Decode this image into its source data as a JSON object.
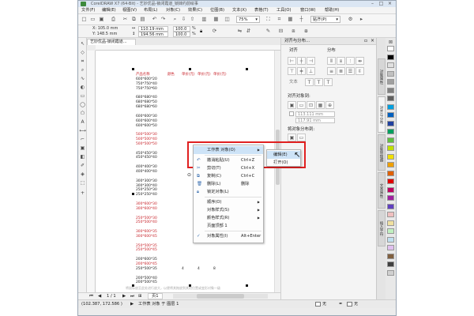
{
  "app": {
    "title": "CorelDRAW X7 (64-Bit) - 艺妙优品-锁闭霞道_锁妹约前绘事"
  },
  "menubar": [
    "文件(F)",
    "编辑(E)",
    "视图(V)",
    "布局(L)",
    "对象(C)",
    "效果(C)",
    "位图(B)",
    "文本(X)",
    "表格(T)",
    "工具(O)",
    "窗口(W)",
    "帮助(H)"
  ],
  "toolbar": {
    "zoom": "75%",
    "snap": "贴齐(P)"
  },
  "propbar": {
    "x": "X: 105.0 mm",
    "y": "Y: 148.5 mm",
    "w": "110.19 mm",
    "h": "194.56 mm",
    "sx": "100.0",
    "sy": "100.0",
    "pct": "%"
  },
  "doc_tab": "艺妙优品-锁闭霞道...",
  "canvas_table": {
    "header": [
      "产品名称",
      "颜色",
      "单价(元)",
      "单价(元)",
      "单价(元)"
    ],
    "rows": [
      [
        "600*600*20",
        "",
        "",
        "",
        ""
      ],
      [
        "750*750*40",
        "",
        "",
        "",
        ""
      ],
      [
        "750*750*60",
        "",
        "",
        "",
        ""
      ],
      [
        "",
        "",
        "",
        "",
        ""
      ],
      [
        "680*680*40",
        "",
        "",
        "",
        ""
      ],
      [
        "680*680*50",
        "",
        "",
        "",
        ""
      ],
      [
        "680*680*60",
        "",
        "",
        "",
        ""
      ],
      [
        "",
        "",
        "",
        "",
        ""
      ],
      [
        "600*600*30",
        "",
        "",
        "",
        ""
      ],
      [
        "600*600*40",
        "",
        "",
        "",
        ""
      ],
      [
        "600*600*50",
        "",
        "",
        "",
        ""
      ],
      [
        "",
        "",
        "",
        "",
        ""
      ],
      [
        "500*500*30",
        "",
        "",
        "",
        ""
      ],
      [
        "500*500*40",
        "",
        "",
        "",
        ""
      ],
      [
        "500*500*50",
        "",
        "",
        "",
        ""
      ],
      [
        "",
        "",
        "",
        "",
        ""
      ],
      [
        "450*450*30",
        "",
        "",
        "",
        ""
      ],
      [
        "450*450*40",
        "",
        "",
        "",
        ""
      ],
      [
        "",
        "",
        "",
        "",
        ""
      ],
      [
        "400*400*30",
        "",
        "",
        "",
        ""
      ],
      [
        "400*400*40",
        "",
        "",
        "",
        ""
      ],
      [
        "",
        "",
        "",
        "",
        ""
      ],
      [
        "300*300*30",
        "",
        "",
        "",
        ""
      ],
      [
        "300*300*40",
        "",
        "",
        "",
        ""
      ],
      [
        "250*250*30",
        "",
        "",
        "",
        ""
      ],
      [
        "250*250*40",
        "",
        "",
        "",
        ""
      ],
      [
        "",
        "",
        "",
        "",
        ""
      ],
      [
        "300*600*30",
        "",
        "",
        "",
        ""
      ],
      [
        "300*600*40",
        "",
        "",
        "",
        ""
      ],
      [
        "",
        "",
        "",
        "",
        ""
      ],
      [
        "250*500*30",
        "",
        "",
        "",
        ""
      ],
      [
        "250*500*40",
        "",
        "",
        "",
        ""
      ],
      [
        "",
        "",
        "",
        "",
        ""
      ],
      [
        "300*600*35",
        "",
        "",
        "",
        ""
      ],
      [
        "300*600*45",
        "",
        "",
        "",
        ""
      ],
      [
        "",
        "",
        "",
        "",
        ""
      ],
      [
        "250*500*35",
        "",
        "",
        "",
        ""
      ],
      [
        "250*500*45",
        "",
        "",
        "",
        ""
      ],
      [
        "",
        "",
        "",
        "",
        ""
      ],
      [
        "200*600*35",
        "",
        "",
        "",
        ""
      ],
      [
        "200*600*45",
        "",
        "",
        "",
        ""
      ],
      [
        "250*500*35",
        "",
        "4",
        "4",
        "8"
      ],
      [
        "",
        "",
        "",
        "",
        ""
      ],
      [
        "200*500*40",
        "",
        "",
        "",
        ""
      ],
      [
        "200*500*45",
        "",
        "",
        "",
        ""
      ]
    ]
  },
  "context_menu": {
    "items": [
      {
        "label": "工作表 对象(O)",
        "shortcut": "",
        "submenu": true,
        "highlighted": true,
        "icon": ""
      },
      {
        "label": "撤消粘贴(U)",
        "shortcut": "Ctrl+Z",
        "submenu": false,
        "highlighted": false,
        "icon": "undo-icon"
      },
      {
        "label": "剪切(T)",
        "shortcut": "Ctrl+X",
        "submenu": false,
        "highlighted": false,
        "icon": "cut-icon"
      },
      {
        "label": "复制(C)",
        "shortcut": "Ctrl+C",
        "submenu": false,
        "highlighted": false,
        "icon": "copy-icon"
      },
      {
        "label": "删除(L)",
        "shortcut": "删除",
        "submenu": false,
        "highlighted": false,
        "icon": "delete-icon"
      },
      {
        "label": "锁定对象(L)",
        "shortcut": "",
        "submenu": false,
        "highlighted": false,
        "icon": "lock-icon"
      },
      {
        "label": "顺序(O)",
        "shortcut": "",
        "submenu": true,
        "highlighted": false,
        "icon": ""
      },
      {
        "label": "对象样式(S)",
        "shortcut": "",
        "submenu": true,
        "highlighted": false,
        "icon": ""
      },
      {
        "label": "颜色样式(R)",
        "shortcut": "",
        "submenu": true,
        "highlighted": false,
        "icon": ""
      },
      {
        "label": "页面顶部 1",
        "shortcut": "",
        "submenu": false,
        "highlighted": false,
        "icon": ""
      },
      {
        "label": "对象属性(I)",
        "shortcut": "Alt+Enter",
        "submenu": false,
        "highlighted": false,
        "icon": "check-icon"
      }
    ]
  },
  "submenu": {
    "items": [
      "编辑(E)",
      "打开(O)"
    ]
  },
  "docker": {
    "title": "对齐与分布...",
    "align_label": "对齐",
    "distribute_label": "分布",
    "text_label": "文本",
    "align_objects_label": "对齐对象到:",
    "x_value": "113.111 mm",
    "y_value": "117.91 mm",
    "distribute_to_label": "将对象分布到:"
  },
  "vertical_tabs": [
    "对象属性",
    "对齐与分布",
    "对象管理器",
    "文本属性",
    "插入字符"
  ],
  "palette": [
    "#ffffff",
    "#000000",
    "#e0e0e0",
    "#c0c0c0",
    "#a0a0a0",
    "#808080",
    "#606060",
    "#00a0e0",
    "#0060c0",
    "#2040a0",
    "#00a060",
    "#60c040",
    "#c0e000",
    "#f0e000",
    "#f0a000",
    "#e06000",
    "#e00000",
    "#c00060",
    "#a020a0",
    "#6040c0",
    "#f0c0c0",
    "#f0e0a0",
    "#c0f0c0",
    "#c0e0f0",
    "#e0c0f0",
    "#806040",
    "#404040",
    "#d0d0d0"
  ],
  "statusbar": {
    "coords": "(102.387, 172.586 )",
    "layer": "工作表 对象 于 图层 1",
    "fill": "无",
    "outline": "无",
    "page": "1 / 1",
    "page_name": "页1"
  },
  "canvas_footer": "将鼠标放至此处进行放大，以便将其拖放到其他位置或变形对象一级"
}
